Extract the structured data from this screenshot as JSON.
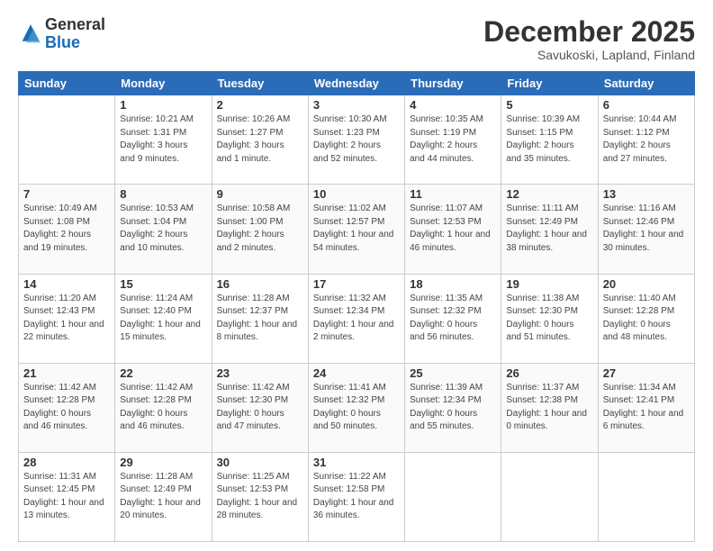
{
  "header": {
    "logo_general": "General",
    "logo_blue": "Blue",
    "month_title": "December 2025",
    "location": "Savukoski, Lapland, Finland"
  },
  "weekdays": [
    "Sunday",
    "Monday",
    "Tuesday",
    "Wednesday",
    "Thursday",
    "Friday",
    "Saturday"
  ],
  "weeks": [
    [
      {
        "day": "",
        "info": ""
      },
      {
        "day": "1",
        "info": "Sunrise: 10:21 AM\nSunset: 1:31 PM\nDaylight: 3 hours\nand 9 minutes."
      },
      {
        "day": "2",
        "info": "Sunrise: 10:26 AM\nSunset: 1:27 PM\nDaylight: 3 hours\nand 1 minute."
      },
      {
        "day": "3",
        "info": "Sunrise: 10:30 AM\nSunset: 1:23 PM\nDaylight: 2 hours\nand 52 minutes."
      },
      {
        "day": "4",
        "info": "Sunrise: 10:35 AM\nSunset: 1:19 PM\nDaylight: 2 hours\nand 44 minutes."
      },
      {
        "day": "5",
        "info": "Sunrise: 10:39 AM\nSunset: 1:15 PM\nDaylight: 2 hours\nand 35 minutes."
      },
      {
        "day": "6",
        "info": "Sunrise: 10:44 AM\nSunset: 1:12 PM\nDaylight: 2 hours\nand 27 minutes."
      }
    ],
    [
      {
        "day": "7",
        "info": "Sunrise: 10:49 AM\nSunset: 1:08 PM\nDaylight: 2 hours\nand 19 minutes."
      },
      {
        "day": "8",
        "info": "Sunrise: 10:53 AM\nSunset: 1:04 PM\nDaylight: 2 hours\nand 10 minutes."
      },
      {
        "day": "9",
        "info": "Sunrise: 10:58 AM\nSunset: 1:00 PM\nDaylight: 2 hours\nand 2 minutes."
      },
      {
        "day": "10",
        "info": "Sunrise: 11:02 AM\nSunset: 12:57 PM\nDaylight: 1 hour and\n54 minutes."
      },
      {
        "day": "11",
        "info": "Sunrise: 11:07 AM\nSunset: 12:53 PM\nDaylight: 1 hour and\n46 minutes."
      },
      {
        "day": "12",
        "info": "Sunrise: 11:11 AM\nSunset: 12:49 PM\nDaylight: 1 hour and\n38 minutes."
      },
      {
        "day": "13",
        "info": "Sunrise: 11:16 AM\nSunset: 12:46 PM\nDaylight: 1 hour and\n30 minutes."
      }
    ],
    [
      {
        "day": "14",
        "info": "Sunrise: 11:20 AM\nSunset: 12:43 PM\nDaylight: 1 hour and\n22 minutes."
      },
      {
        "day": "15",
        "info": "Sunrise: 11:24 AM\nSunset: 12:40 PM\nDaylight: 1 hour and\n15 minutes."
      },
      {
        "day": "16",
        "info": "Sunrise: 11:28 AM\nSunset: 12:37 PM\nDaylight: 1 hour and\n8 minutes."
      },
      {
        "day": "17",
        "info": "Sunrise: 11:32 AM\nSunset: 12:34 PM\nDaylight: 1 hour and\n2 minutes."
      },
      {
        "day": "18",
        "info": "Sunrise: 11:35 AM\nSunset: 12:32 PM\nDaylight: 0 hours\nand 56 minutes."
      },
      {
        "day": "19",
        "info": "Sunrise: 11:38 AM\nSunset: 12:30 PM\nDaylight: 0 hours\nand 51 minutes."
      },
      {
        "day": "20",
        "info": "Sunrise: 11:40 AM\nSunset: 12:28 PM\nDaylight: 0 hours\nand 48 minutes."
      }
    ],
    [
      {
        "day": "21",
        "info": "Sunrise: 11:42 AM\nSunset: 12:28 PM\nDaylight: 0 hours\nand 46 minutes."
      },
      {
        "day": "22",
        "info": "Sunrise: 11:42 AM\nSunset: 12:28 PM\nDaylight: 0 hours\nand 46 minutes."
      },
      {
        "day": "23",
        "info": "Sunrise: 11:42 AM\nSunset: 12:30 PM\nDaylight: 0 hours\nand 47 minutes."
      },
      {
        "day": "24",
        "info": "Sunrise: 11:41 AM\nSunset: 12:32 PM\nDaylight: 0 hours\nand 50 minutes."
      },
      {
        "day": "25",
        "info": "Sunrise: 11:39 AM\nSunset: 12:34 PM\nDaylight: 0 hours\nand 55 minutes."
      },
      {
        "day": "26",
        "info": "Sunrise: 11:37 AM\nSunset: 12:38 PM\nDaylight: 1 hour and\n0 minutes."
      },
      {
        "day": "27",
        "info": "Sunrise: 11:34 AM\nSunset: 12:41 PM\nDaylight: 1 hour and\n6 minutes."
      }
    ],
    [
      {
        "day": "28",
        "info": "Sunrise: 11:31 AM\nSunset: 12:45 PM\nDaylight: 1 hour and\n13 minutes."
      },
      {
        "day": "29",
        "info": "Sunrise: 11:28 AM\nSunset: 12:49 PM\nDaylight: 1 hour and\n20 minutes."
      },
      {
        "day": "30",
        "info": "Sunrise: 11:25 AM\nSunset: 12:53 PM\nDaylight: 1 hour and\n28 minutes."
      },
      {
        "day": "31",
        "info": "Sunrise: 11:22 AM\nSunset: 12:58 PM\nDaylight: 1 hour and\n36 minutes."
      },
      {
        "day": "",
        "info": ""
      },
      {
        "day": "",
        "info": ""
      },
      {
        "day": "",
        "info": ""
      }
    ]
  ]
}
